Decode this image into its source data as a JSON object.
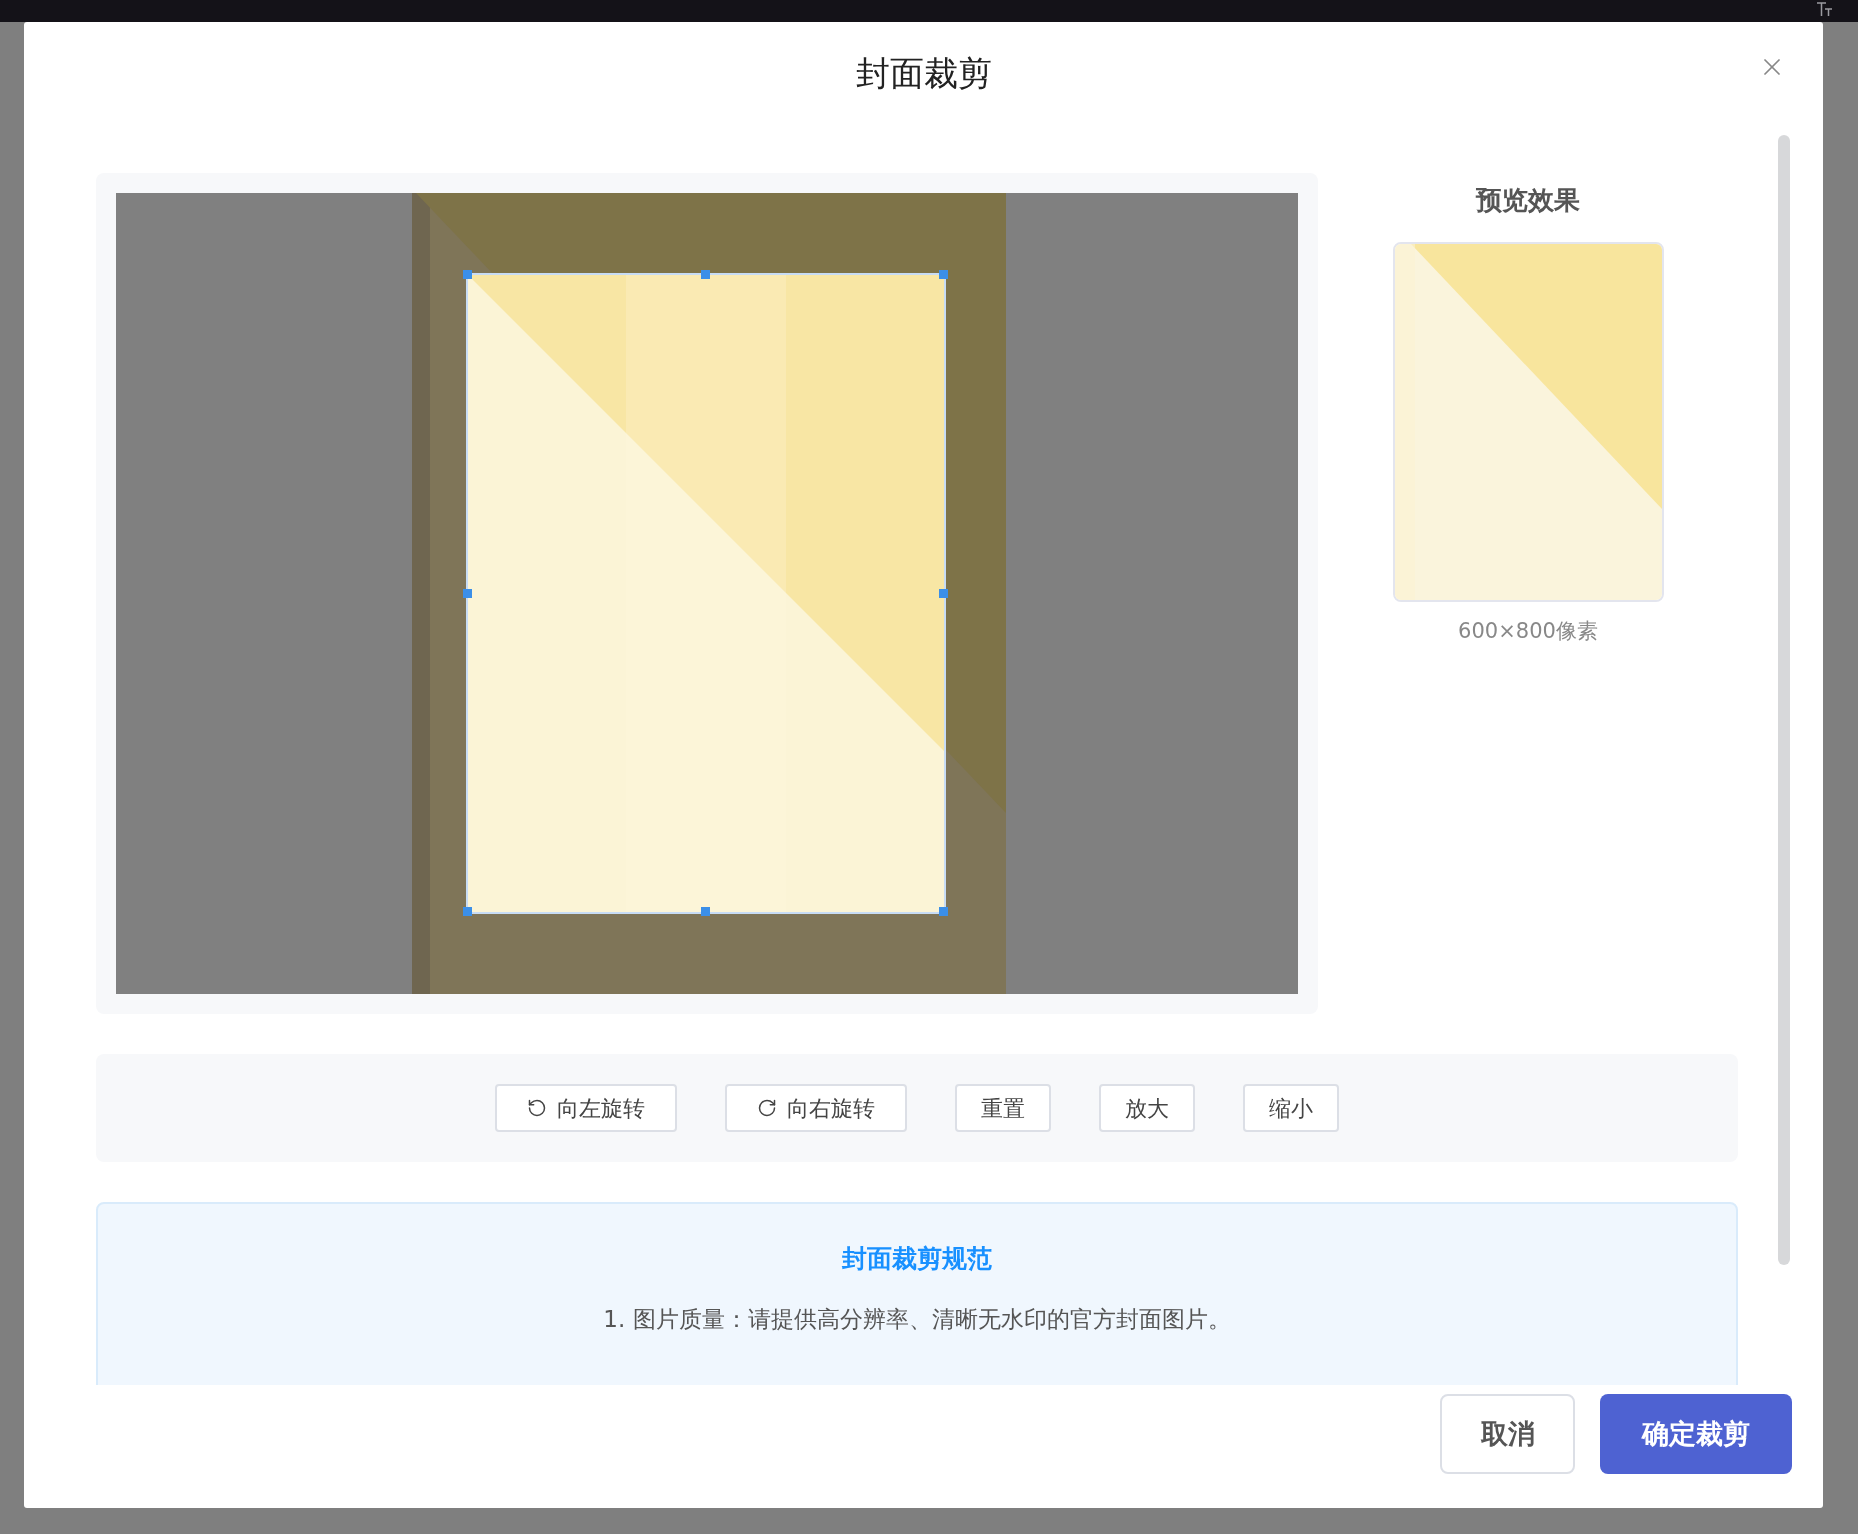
{
  "dialog": {
    "title": "封面裁剪"
  },
  "preview": {
    "title": "预览效果",
    "caption": "600×800像素"
  },
  "toolbar": [
    {
      "label": "向左旋转",
      "kind": "rotate-left"
    },
    {
      "label": "向右旋转",
      "kind": "rotate-right"
    },
    {
      "label": "重置",
      "kind": "plain"
    },
    {
      "label": "放大",
      "kind": "plain"
    },
    {
      "label": "缩小",
      "kind": "plain"
    }
  ],
  "rules": {
    "title": "封面裁剪规范",
    "items": [
      "1. 图片质量：请提供高分辨率、清晰无水印的官方封面图片。"
    ]
  },
  "footer": [
    {
      "label": "取消",
      "kind": "secondary"
    },
    {
      "label": "确定裁剪",
      "kind": "primary"
    }
  ]
}
